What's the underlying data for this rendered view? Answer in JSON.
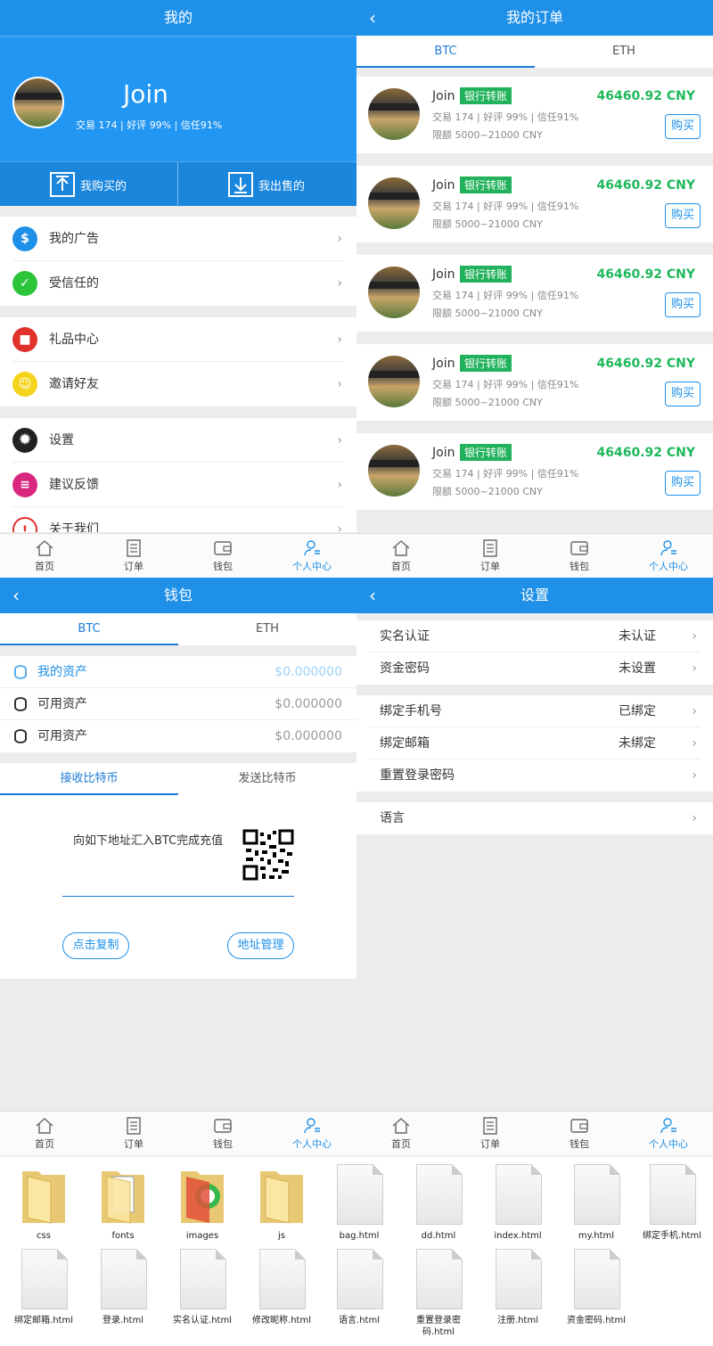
{
  "my": {
    "title": "我的",
    "username": "Join",
    "stats": "交易 174 | 好评 99% | 信任91%",
    "buy_label": "我购买的",
    "sell_label": "我出售的",
    "menu": [
      {
        "label": "我的广告"
      },
      {
        "label": "受信任的"
      },
      {
        "label": "礼品中心"
      },
      {
        "label": "邀请好友"
      },
      {
        "label": "设置"
      },
      {
        "label": "建议反馈"
      },
      {
        "label": "关于我们"
      }
    ]
  },
  "tabbar": {
    "items": [
      "首页",
      "订单",
      "钱包",
      "个人中心"
    ]
  },
  "orders": {
    "title": "我的订单",
    "tabs": [
      "BTC",
      "ETH"
    ],
    "cards": [
      {
        "name": "Join",
        "tag": "银行转账",
        "stats": "交易 174 | 好评 99% | 信任91%",
        "limit": "限额 5000~21000 CNY",
        "price": "46460.92 CNY",
        "buy": "购买"
      },
      {
        "name": "Join",
        "tag": "银行转账",
        "stats": "交易 174 | 好评 99% | 信任91%",
        "limit": "限额 5000~21000 CNY",
        "price": "46460.92 CNY",
        "buy": "购买"
      },
      {
        "name": "Join",
        "tag": "银行转账",
        "stats": "交易 174 | 好评 99% | 信任91%",
        "limit": "限额 5000~21000 CNY",
        "price": "46460.92 CNY",
        "buy": "购买"
      },
      {
        "name": "Join",
        "tag": "银行转账",
        "stats": "交易 174 | 好评 99% | 信任91%",
        "limit": "限额 5000~21000 CNY",
        "price": "46460.92 CNY",
        "buy": "购买"
      },
      {
        "name": "Join",
        "tag": "银行转账",
        "stats": "交易 174 | 好评 99% | 信任91%",
        "limit": "限额 5000~21000 CNY",
        "price": "46460.92 CNY",
        "buy": "购买"
      }
    ]
  },
  "wallet": {
    "title": "钱包",
    "tabs": [
      "BTC",
      "ETH"
    ],
    "assets": [
      {
        "label": "我的资产",
        "value": "$0.000000"
      },
      {
        "label": "可用资产",
        "value": "$0.000000"
      },
      {
        "label": "可用资产",
        "value": "$0.000000"
      }
    ],
    "subtabs": [
      "接收比特币",
      "发送比特币"
    ],
    "deposit_text": "向如下地址汇入BTC完成充值",
    "copy_label": "点击复制",
    "manage_label": "地址管理"
  },
  "settings": {
    "title": "设置",
    "group1": [
      {
        "label": "实名认证",
        "value": "未认证"
      },
      {
        "label": "资金密码",
        "value": "未设置"
      }
    ],
    "group2": [
      {
        "label": "绑定手机号",
        "value": "已绑定"
      },
      {
        "label": "绑定邮箱",
        "value": "未绑定"
      },
      {
        "label": "重置登录密码",
        "value": ""
      }
    ],
    "group3": [
      {
        "label": "语言",
        "value": ""
      }
    ]
  },
  "files": [
    "css",
    "fonts",
    "images",
    "js",
    "bag.html",
    "dd.html",
    "index.html",
    "my.html",
    "绑定手机.html",
    "绑定邮箱.html",
    "登录.html",
    "实名认证.html",
    "修改昵称.html",
    "语言.html",
    "重置登录密码.html",
    "注册.html",
    "资金密码.html"
  ],
  "colors": {
    "primary": "#1e90e8",
    "price": "#20b85c",
    "tag": "#21b25b"
  }
}
